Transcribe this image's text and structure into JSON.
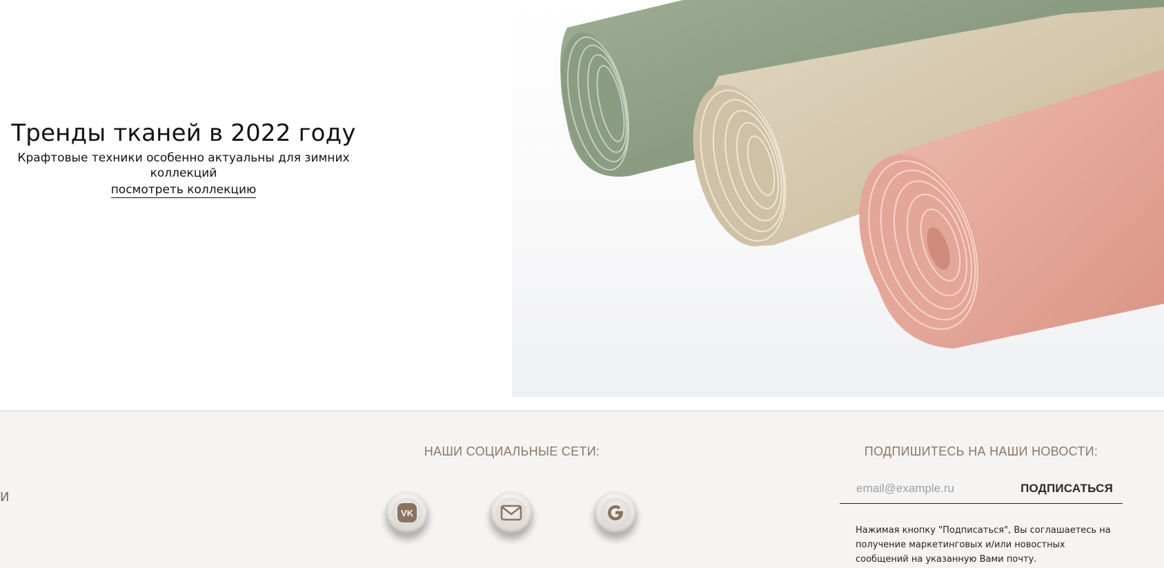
{
  "hero": {
    "title": "Тренды тканей в 2022 году",
    "subtitle": "Крафтовые техники особенно актуальны для зимних коллекций",
    "link_label": "посмотреть коллекцию",
    "image_name": "fabric-rolls-image"
  },
  "footer": {
    "edge_char": "И",
    "social": {
      "heading": "НАШИ СОЦИАЛЬНЫЕ СЕТИ:",
      "items": [
        {
          "icon": "vk-icon"
        },
        {
          "icon": "mail-icon"
        },
        {
          "icon": "google-icon"
        }
      ]
    },
    "subscribe": {
      "heading": "ПОДПИШИТЕСЬ НА НАШИ НОВОСТИ:",
      "email_placeholder": "email@example.ru",
      "email_value": "",
      "button_label": "ПОДПИСАТЬСЯ",
      "note": "Нажимая кнопку \"Подписаться\", Вы соглашаетесь на получение маркетинговых и/или новостных сообщений на указанную Вами почту."
    }
  },
  "colors": {
    "footer_bg": "#f5f4f2",
    "heading_brown": "#8b7766",
    "icon_brown": "#8a735f",
    "roll_green": "#8fa086",
    "roll_beige": "#d3c6ac",
    "roll_pink": "#e3a99d"
  }
}
